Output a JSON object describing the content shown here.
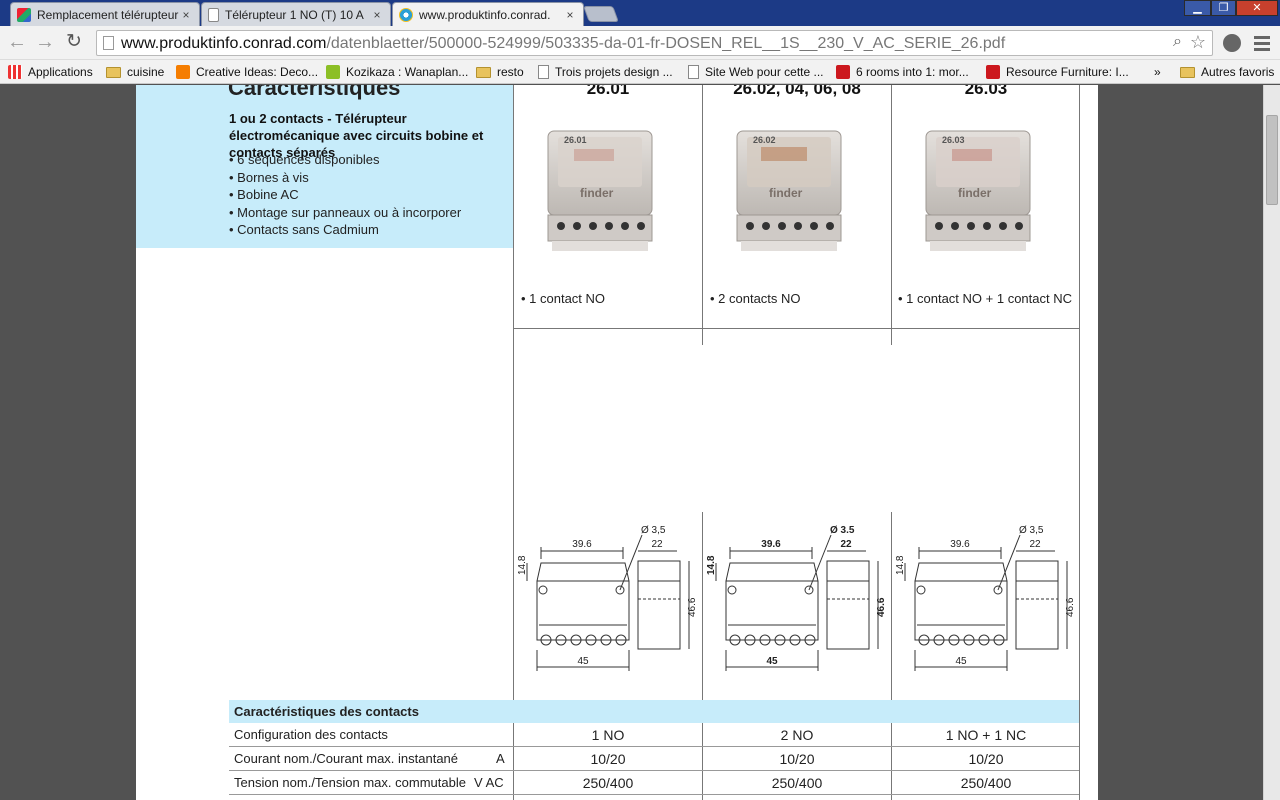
{
  "tabs": [
    {
      "title": "Remplacement télérupteur",
      "close": "×",
      "active": false
    },
    {
      "title": "Télérupteur 1 NO (T) 10 A",
      "close": "×",
      "active": false
    },
    {
      "title": "www.produktinfo.conrad.",
      "close": "×",
      "active": true
    }
  ],
  "address_bar": {
    "host": "www.produktinfo.conrad.com",
    "path": "/datenblaetter/500000-524999/503335-da-01-fr-DOSEN_REL__1S__230_V_AC_SERIE_26.pdf"
  },
  "bookmarks": [
    {
      "label": "Applications",
      "icon": "apps-grid-icon"
    },
    {
      "label": "cuisine",
      "icon": "folder-icon"
    },
    {
      "label": "Creative Ideas: Deco...",
      "icon": "blogger-icon"
    },
    {
      "label": "Kozikaza : Wanaplan...",
      "icon": "kozikaza-icon"
    },
    {
      "label": "resto",
      "icon": "folder-icon"
    },
    {
      "label": "Trois projets design ...",
      "icon": "page-icon"
    },
    {
      "label": "Site Web pour cette ...",
      "icon": "page-icon"
    },
    {
      "label": "6 rooms into 1: mor...",
      "icon": "youtube-icon"
    },
    {
      "label": "Resource Furniture: I...",
      "icon": "youtube-icon"
    }
  ],
  "bookmarks_overflow": "»",
  "other_bookmarks": "Autres favoris",
  "doc": {
    "section_title": "Caractéristiques",
    "subtitle": "1 ou 2 contacts - Télérupteur électromécanique avec circuits bobine et contacts séparés",
    "features": [
      "• 6 séquences disponibles",
      "• Bornes à vis",
      "• Bobine AC",
      "• Montage sur panneaux ou à incorporer",
      "• Contacts sans Cadmium"
    ],
    "products": [
      {
        "model": "26.01",
        "relay_label": "26.01",
        "brand": "finder",
        "caption": "• 1 contact NO"
      },
      {
        "model": "26.02, 04, 06, 08",
        "relay_label": "26.02",
        "brand": "finder",
        "caption": "• 2 contacts NO"
      },
      {
        "model": "26.03",
        "relay_label": "26.03",
        "brand": "finder",
        "caption": "• 1 contact NO + 1 contact NC"
      }
    ],
    "dimensions": [
      {
        "width_top": "39.6",
        "hole": "Ø 3,5",
        "depth": "22",
        "side": "14.8",
        "height": "46.6",
        "base": "45",
        "bold": false
      },
      {
        "width_top": "39.6",
        "hole": "Ø 3.5",
        "depth": "22",
        "side": "14.8",
        "height": "46.6",
        "base": "45",
        "bold": true
      },
      {
        "width_top": "39.6",
        "hole": "Ø 3,5",
        "depth": "22",
        "side": "14.8",
        "height": "46.6",
        "base": "45",
        "bold": false
      }
    ],
    "table": {
      "header": "Caractéristiques des contacts",
      "rows": [
        {
          "label": "Configuration des contacts",
          "unit": "",
          "values": [
            "1 NO",
            "2 NO",
            "1 NO + 1 NC"
          ]
        },
        {
          "label": "Courant nom./Courant max. instantané",
          "unit": "A",
          "values": [
            "10/20",
            "10/20",
            "10/20"
          ]
        },
        {
          "label": "Tension nom./Tension max. commutable",
          "unit": "V AC",
          "values": [
            "250/400",
            "250/400",
            "250/400"
          ]
        }
      ]
    }
  }
}
